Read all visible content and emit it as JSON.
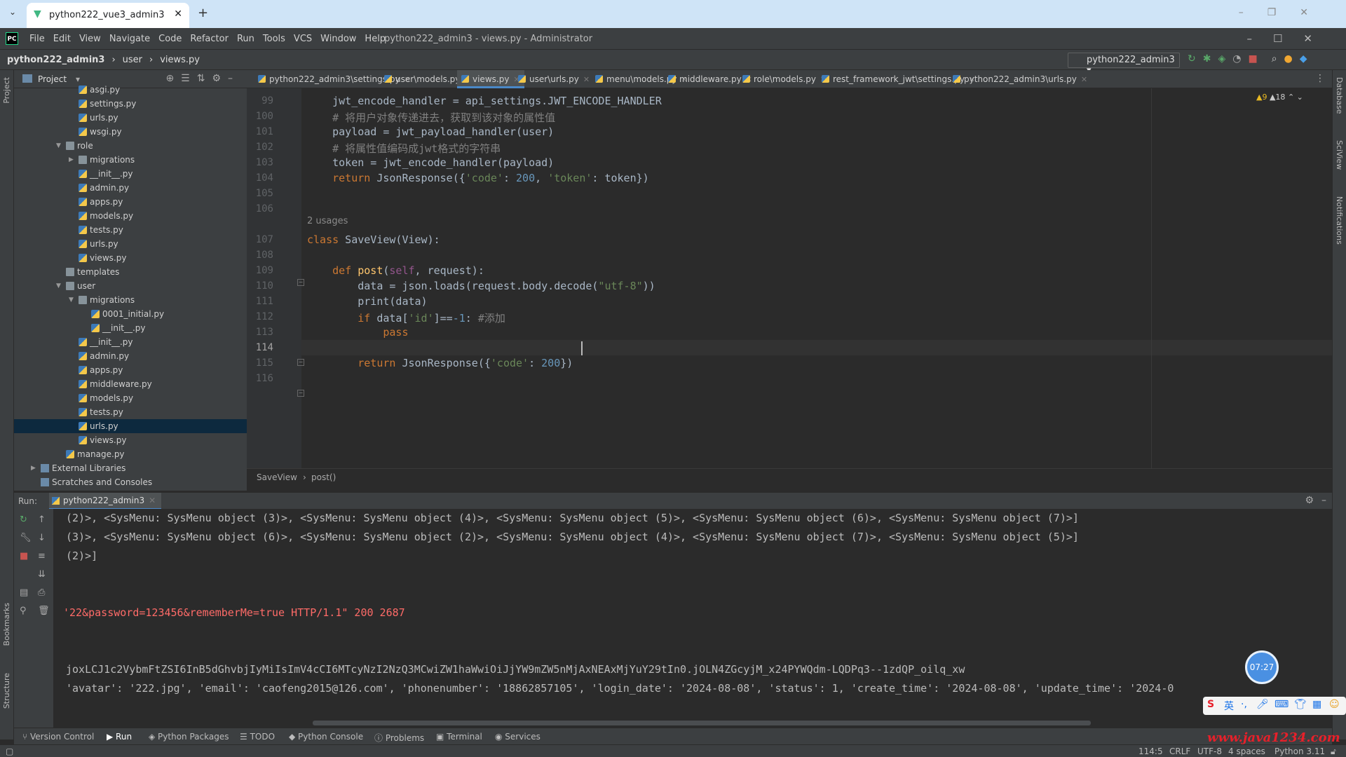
{
  "browser": {
    "tab_title": "python222_vue3_admin3",
    "close": "✕",
    "new_tab": "+",
    "dropdown": "⌄",
    "window_controls": "–❐✕"
  },
  "ide": {
    "logo": "PC",
    "menu": [
      "File",
      "Edit",
      "View",
      "Navigate",
      "Code",
      "Refactor",
      "Run",
      "Tools",
      "VCS",
      "Window",
      "Help"
    ],
    "window_title": "python222_admin3 - views.py - Administrator",
    "window_controls": "–☐✕"
  },
  "navbar": {
    "project": "python222_admin3",
    "folder": "user",
    "file": "views.py",
    "run_config": "python222_admin3"
  },
  "left_strip": {
    "project": "Project",
    "bookmarks": "Bookmarks",
    "structure": "Structure"
  },
  "right_strip": {
    "database": "Database",
    "sciview": "SciView",
    "notifications": "Notifications"
  },
  "project_panel": {
    "title": "Project",
    "tree": [
      {
        "label": "asgi.py",
        "depth": 3,
        "type": "py"
      },
      {
        "label": "settings.py",
        "depth": 3,
        "type": "py"
      },
      {
        "label": "urls.py",
        "depth": 3,
        "type": "py"
      },
      {
        "label": "wsgi.py",
        "depth": 3,
        "type": "py"
      },
      {
        "label": "role",
        "depth": 2,
        "type": "dir",
        "open": true
      },
      {
        "label": "migrations",
        "depth": 3,
        "type": "dir",
        "open": false
      },
      {
        "label": "__init__.py",
        "depth": 3,
        "type": "py"
      },
      {
        "label": "admin.py",
        "depth": 3,
        "type": "py"
      },
      {
        "label": "apps.py",
        "depth": 3,
        "type": "py"
      },
      {
        "label": "models.py",
        "depth": 3,
        "type": "py"
      },
      {
        "label": "tests.py",
        "depth": 3,
        "type": "py"
      },
      {
        "label": "urls.py",
        "depth": 3,
        "type": "py"
      },
      {
        "label": "views.py",
        "depth": 3,
        "type": "py"
      },
      {
        "label": "templates",
        "depth": 2,
        "type": "dir"
      },
      {
        "label": "user",
        "depth": 2,
        "type": "dir",
        "open": true
      },
      {
        "label": "migrations",
        "depth": 3,
        "type": "dir",
        "open": true
      },
      {
        "label": "0001_initial.py",
        "depth": 4,
        "type": "py"
      },
      {
        "label": "__init__.py",
        "depth": 4,
        "type": "py"
      },
      {
        "label": "__init__.py",
        "depth": 3,
        "type": "py"
      },
      {
        "label": "admin.py",
        "depth": 3,
        "type": "py"
      },
      {
        "label": "apps.py",
        "depth": 3,
        "type": "py"
      },
      {
        "label": "middleware.py",
        "depth": 3,
        "type": "py"
      },
      {
        "label": "models.py",
        "depth": 3,
        "type": "py"
      },
      {
        "label": "tests.py",
        "depth": 3,
        "type": "py"
      },
      {
        "label": "urls.py",
        "depth": 3,
        "type": "py",
        "selected": true
      },
      {
        "label": "views.py",
        "depth": 3,
        "type": "py"
      },
      {
        "label": "manage.py",
        "depth": 2,
        "type": "py"
      },
      {
        "label": "External Libraries",
        "depth": 0,
        "type": "lib",
        "open": false
      },
      {
        "label": "Scratches and Consoles",
        "depth": 0,
        "type": "lib"
      }
    ]
  },
  "editor_tabs": [
    {
      "label": "python222_admin3\\settings.py"
    },
    {
      "label": "user\\models.py"
    },
    {
      "label": "views.py",
      "active": true
    },
    {
      "label": "user\\urls.py"
    },
    {
      "label": "menu\\models.py"
    },
    {
      "label": "middleware.py"
    },
    {
      "label": "role\\models.py"
    },
    {
      "label": "rest_framework_jwt\\settings.py"
    },
    {
      "label": "python222_admin3\\urls.py"
    }
  ],
  "editor": {
    "inspection": {
      "warnings": "▲9",
      "weak": "▲18"
    },
    "usages": "2 usages",
    "line_numbers": [
      "99",
      "100",
      "101",
      "102",
      "103",
      "104",
      "105",
      "106",
      "107",
      "108",
      "109",
      "110",
      "111",
      "112",
      "113",
      "114",
      "115",
      "116"
    ],
    "current_line": "114",
    "crumb": {
      "class": "SaveView",
      "method": "post()"
    }
  },
  "run": {
    "label": "Run:",
    "tab": "python222_admin3",
    "console": [
      {
        "text": "(2)>, <SysMenu: SysMenu object (3)>, <SysMenu: SysMenu object (4)>, <SysMenu: SysMenu object (5)>, <SysMenu: SysMenu object (6)>, <SysMenu: SysMenu object (7)>]",
        "err": false
      },
      {
        "text": "(3)>, <SysMenu: SysMenu object (6)>, <SysMenu: SysMenu object (2)>, <SysMenu: SysMenu object (4)>, <SysMenu: SysMenu object (7)>, <SysMenu: SysMenu object (5)>]",
        "err": false
      },
      {
        "text": "(2)>]",
        "err": false
      },
      {
        "text": "'22&password=123456&rememberMe=true HTTP/1.1\" 200 2687",
        "err": true
      },
      {
        "text": "joxLCJ1c2VybmFtZSI6InB5dGhvbjIyMiIsImV4cCI6MTcyNzI2NzQ3MCwiZW1haWwiOiJjYW9mZW5nMjAxNEAxMjYuY29tIn0.jOLN4ZGcyjM_x24PYWQdm-LQDPq3--1zdQP_oilq_xw",
        "err": false
      },
      {
        "text": "'avatar': '222.jpg', 'email': 'caofeng2015@126.com', 'phonenumber': '18862857105', 'login_date': '2024-08-08', 'status': 1, 'create_time': '2024-08-08', 'update_time': '2024-0",
        "err": false
      }
    ]
  },
  "overlays": {
    "timer": "07:27",
    "watermark": "www.java1234.com"
  },
  "bottom_tools": [
    "Version Control",
    "Run",
    "Python Packages",
    "TODO",
    "Python Console",
    "Problems",
    "Terminal",
    "Services"
  ],
  "status": {
    "position": "114:5",
    "line_sep": "CRLF",
    "encoding": "UTF-8",
    "indent": "4 spaces",
    "interpreter": "Python 3.11"
  }
}
